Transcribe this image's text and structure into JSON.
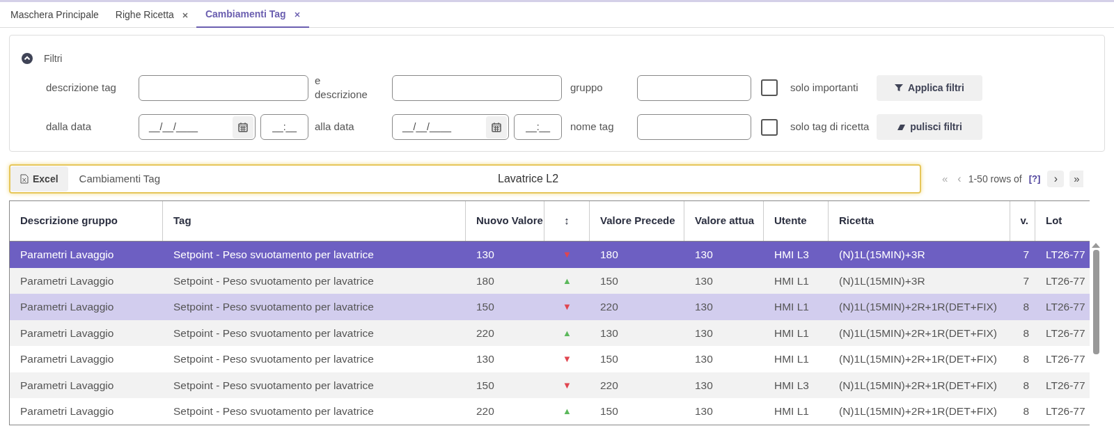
{
  "tabs": [
    {
      "label": "Maschera Principale",
      "closable": false,
      "selected": false
    },
    {
      "label": "Righe Ricetta",
      "closable": true,
      "selected": false
    },
    {
      "label": "Cambiamenti Tag",
      "closable": true,
      "selected": true
    }
  ],
  "filters": {
    "title": "Filtri",
    "expanded": true,
    "row1": {
      "label1": "descrizione tag",
      "label2": "e descrizione",
      "label3": "gruppo",
      "check_label": "solo importanti",
      "checked": false,
      "button": "Applica filtri"
    },
    "row2": {
      "label1": "dalla data",
      "date1": "__/__/____",
      "time1": "__:__",
      "label2": "alla data",
      "date2": "__/__/____",
      "time2": "__:__",
      "label3": "nome tag",
      "check_label": "solo tag di ricetta",
      "checked": false,
      "button": "pulisci filtri"
    }
  },
  "toolbar": {
    "excel_button": "Excel",
    "title": "Cambiamenti Tag",
    "subtitle": "Lavatrice L2"
  },
  "pagination": {
    "first": "«",
    "prev": "‹",
    "range": "1-50 rows of",
    "total_link": "[?]",
    "next": "›",
    "last": "»"
  },
  "table": {
    "columns": [
      "Descrizione gruppo",
      "Tag",
      "Nuovo Valore",
      "↕",
      "Valore Precede",
      "Valore attua",
      "Utente",
      "Ricetta",
      "v.",
      "Lot"
    ],
    "rows": [
      {
        "selected": true,
        "hovered": false,
        "cells": [
          "Parametri Lavaggio",
          "Setpoint - Peso svuotamento per lavatrice",
          "130",
          "▼",
          "180",
          "130",
          "HMI L3",
          "(N)1L(15MIN)+3R",
          "7",
          "LT26-77"
        ]
      },
      {
        "selected": false,
        "hovered": false,
        "cells": [
          "Parametri Lavaggio",
          "Setpoint - Peso svuotamento per lavatrice",
          "180",
          "▲",
          "150",
          "130",
          "HMI L1",
          "(N)1L(15MIN)+3R",
          "7",
          "LT26-77"
        ]
      },
      {
        "selected": false,
        "hovered": true,
        "cells": [
          "Parametri Lavaggio",
          "Setpoint - Peso svuotamento per lavatrice",
          "150",
          "▼",
          "220",
          "130",
          "HMI L1",
          "(N)1L(15MIN)+2R+1R(DET+FIX)",
          "8",
          "LT26-77"
        ]
      },
      {
        "selected": false,
        "hovered": false,
        "cells": [
          "Parametri Lavaggio",
          "Setpoint - Peso svuotamento per lavatrice",
          "220",
          "▲",
          "130",
          "130",
          "HMI L1",
          "(N)1L(15MIN)+2R+1R(DET+FIX)",
          "8",
          "LT26-77"
        ]
      },
      {
        "selected": false,
        "hovered": false,
        "cells": [
          "Parametri Lavaggio",
          "Setpoint - Peso svuotamento per lavatrice",
          "130",
          "▼",
          "150",
          "130",
          "HMI L1",
          "(N)1L(15MIN)+2R+1R(DET+FIX)",
          "8",
          "LT26-77"
        ]
      },
      {
        "selected": false,
        "hovered": false,
        "cells": [
          "Parametri Lavaggio",
          "Setpoint - Peso svuotamento per lavatrice",
          "150",
          "▼",
          "220",
          "130",
          "HMI L3",
          "(N)1L(15MIN)+2R+1R(DET+FIX)",
          "8",
          "LT26-77"
        ]
      },
      {
        "selected": false,
        "hovered": false,
        "cells": [
          "Parametri Lavaggio",
          "Setpoint - Peso svuotamento per lavatrice",
          "220",
          "▲",
          "150",
          "130",
          "HMI L1",
          "(N)1L(15MIN)+2R+1R(DET+FIX)",
          "8",
          "LT26-77"
        ]
      }
    ]
  }
}
